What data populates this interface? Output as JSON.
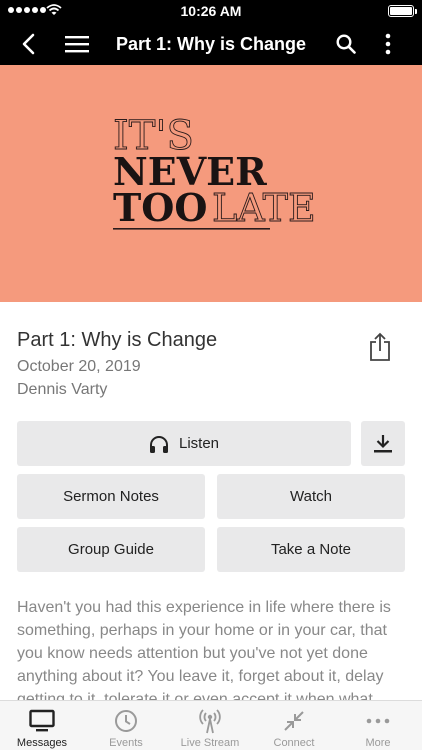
{
  "status_bar": {
    "time": "10:26 AM"
  },
  "nav": {
    "title": "Part 1: Why is Change"
  },
  "hero": {
    "background": "#f59a7d",
    "line1": "IT'S",
    "line2": "NEVER",
    "line3a": "TOO",
    "line3b": "LATE"
  },
  "sermon": {
    "title": "Part 1: Why is Change",
    "date": "October 20, 2019",
    "speaker": "Dennis Varty"
  },
  "actions": {
    "listen": "Listen",
    "sermon_notes": "Sermon Notes",
    "watch": "Watch",
    "group_guide": "Group Guide",
    "take_note": "Take a Note"
  },
  "description": "Haven't you had this experience in life where there is something, perhaps in your home or in your car, that you know needs attention but you've not yet done anything about it? You leave it, forget about it, delay getting to it, tolerate it or even accept it when what",
  "tabs": [
    {
      "label": "Messages",
      "icon": "tv-icon",
      "active": true
    },
    {
      "label": "Events",
      "icon": "clock-icon"
    },
    {
      "label": "Live Stream",
      "icon": "broadcast-icon"
    },
    {
      "label": "Connect",
      "icon": "arrows-in-icon"
    },
    {
      "label": "More",
      "icon": "dots-icon"
    }
  ]
}
